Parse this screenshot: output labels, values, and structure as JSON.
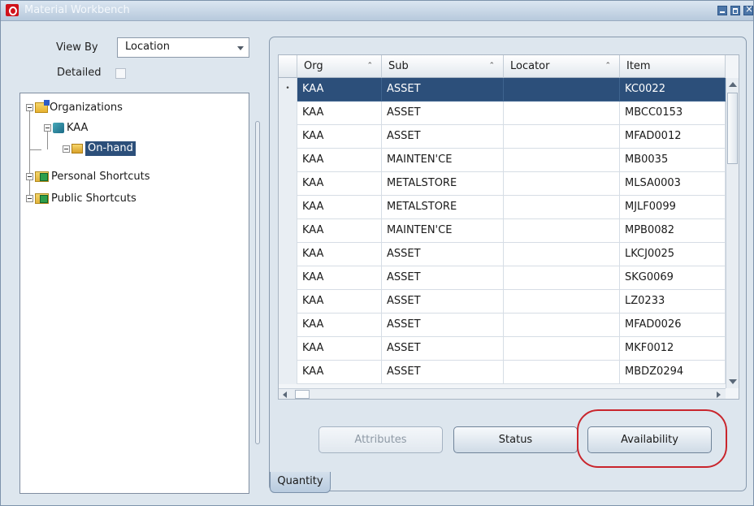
{
  "window": {
    "title": "Material Workbench"
  },
  "filters": {
    "view_by_label": "View By",
    "view_by_value": "Location",
    "detailed_label": "Detailed"
  },
  "tree": {
    "root": "Organizations",
    "org": "KAA",
    "onhand": "On-hand",
    "personal": "Personal Shortcuts",
    "public": "Public Shortcuts"
  },
  "grid": {
    "columns": [
      "Org",
      "Sub",
      "Locator",
      "Item"
    ],
    "rows": [
      [
        "KAA",
        "ASSET",
        "",
        "KC0022"
      ],
      [
        "KAA",
        "ASSET",
        "",
        "MBCC0153"
      ],
      [
        "KAA",
        "ASSET",
        "",
        "MFAD0012"
      ],
      [
        "KAA",
        "MAINTEN'CE",
        "",
        "MB0035"
      ],
      [
        "KAA",
        "METALSTORE",
        "",
        "MLSA0003"
      ],
      [
        "KAA",
        "METALSTORE",
        "",
        "MJLF0099"
      ],
      [
        "KAA",
        "MAINTEN'CE",
        "",
        "MPB0082"
      ],
      [
        "KAA",
        "ASSET",
        "",
        "LKCJ0025"
      ],
      [
        "KAA",
        "ASSET",
        "",
        "SKG0069"
      ],
      [
        "KAA",
        "ASSET",
        "",
        "LZ0233"
      ],
      [
        "KAA",
        "ASSET",
        "",
        "MFAD0026"
      ],
      [
        "KAA",
        "ASSET",
        "",
        "MKF0012"
      ],
      [
        "KAA",
        "ASSET",
        "",
        "MBDZ0294"
      ]
    ]
  },
  "buttons": {
    "attributes": "Attributes",
    "status": "Status",
    "availability": "Availability"
  },
  "tabs": {
    "quantity": "Quantity"
  },
  "colors": {
    "selection": "#2c4f7a",
    "highlight_ring": "#c9252c"
  }
}
